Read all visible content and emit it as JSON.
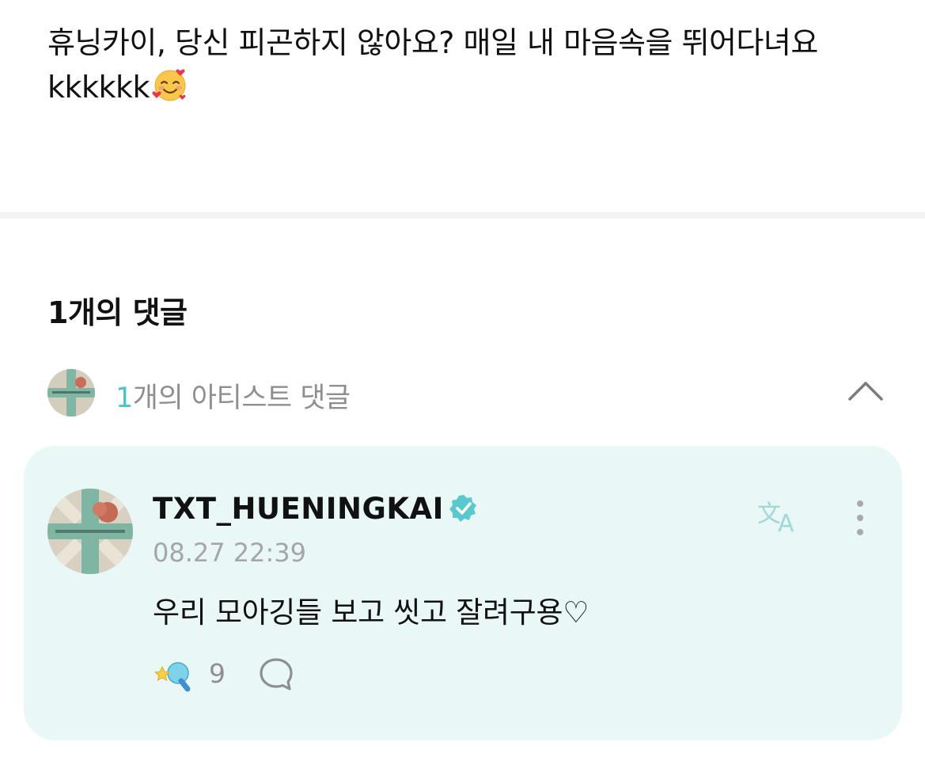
{
  "post": {
    "body_text": "휴닝카이, 당신 피곤하지 않아요? 매일 내 마음속을 뛰어다녀요kkkkkk",
    "emoji": "smiling-face-with-hearts"
  },
  "comments": {
    "title": "1개의 댓글",
    "artist_count_number": "1",
    "artist_count_suffix": "개의 아티스트 댓글"
  },
  "comment": {
    "username": "TXT_HUENINGKAI",
    "verified": true,
    "timestamp": "08.27 22:39",
    "text": "우리 모아깅들 보고 씻고 잘려구용♡",
    "reaction_count": "9"
  },
  "colors": {
    "accent": "#4dc3c7",
    "card_bg": "#e9f8f6",
    "muted": "#8e8e93"
  }
}
